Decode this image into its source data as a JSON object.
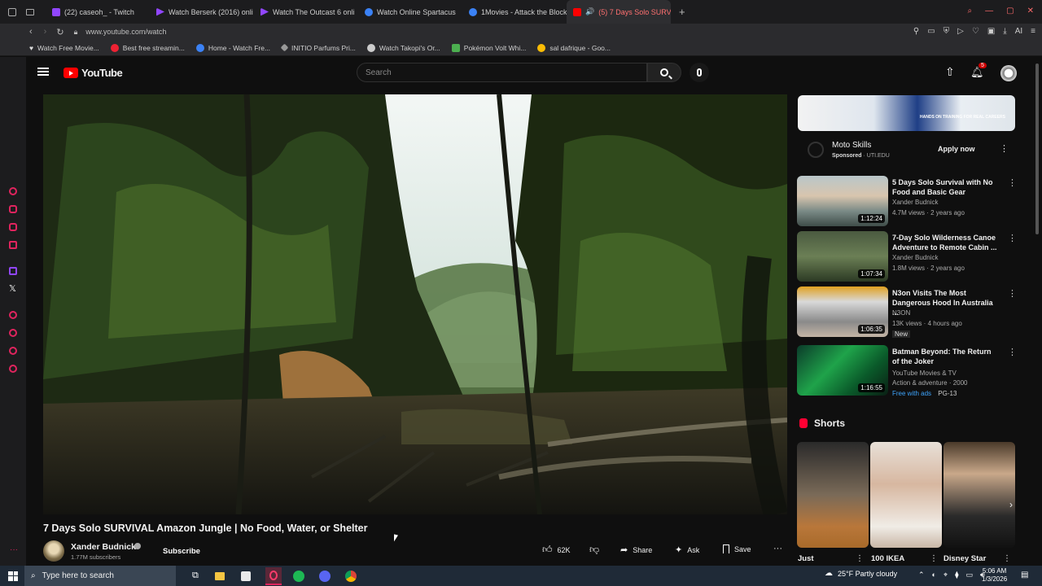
{
  "browser": {
    "tabs": [
      {
        "label": "(22) caseoh_ - Twitch",
        "color": "#9146ff"
      },
      {
        "label": "Watch Berserk (2016) onli",
        "color": "#9146ff"
      },
      {
        "label": "Watch The Outcast 6 onli",
        "color": "#9146ff"
      },
      {
        "label": "Watch Online Spartacus",
        "color": "#3b82f6"
      },
      {
        "label": "1Movies - Attack the Block",
        "color": "#3b82f6"
      },
      {
        "label": "(5) 7 Days Solo SURVI",
        "color": "#ff0000"
      }
    ],
    "new_tab": "+",
    "url": "www.youtube.com/watch",
    "bookmarks": [
      "Watch Free Movie...",
      "Best free streamin...",
      "Home - Watch Fre...",
      "INITIO Parfums Pri...",
      "Watch Takopi's Or...",
      "Pokémon Volt Whi...",
      "sal dafrique - Goo..."
    ],
    "toolbar_right": "AI"
  },
  "youtube": {
    "logo": "YouTube",
    "search_placeholder": "Search",
    "notif_count": "5",
    "video": {
      "title": "7 Days Solo SURVIVAL Amazon Jungle | No Food, Water, or Shelter",
      "channel": "Xander Budnick",
      "subscribers": "1.77M subscribers",
      "subscribe": "Subscribe",
      "likes": "62K",
      "share": "Share",
      "ask": "Ask",
      "save": "Save"
    },
    "ad": {
      "name": "Moto Skills",
      "sponsored": "Sponsored",
      "domain": "· UTI.EDU",
      "cta": "Apply now",
      "banner_text": "HANDS ON TRAINING FOR REAL CAREERS"
    },
    "related": [
      {
        "title": "5 Days Solo Survival with No Food and Basic Gear",
        "channel": "Xander Budnick",
        "meta": "4.7M views · 2 years ago",
        "duration": "1:12:24",
        "extra": ""
      },
      {
        "title": "7-Day Solo Wilderness Canoe Adventure to Remote Cabin ...",
        "channel": "Xander Budnick",
        "meta": "1.8M views · 2 years ago",
        "duration": "1:07:34",
        "extra": ""
      },
      {
        "title": "N3on Visits The Most Dangerous Hood In Australia ...",
        "channel": "N3ON",
        "meta": "13K views · 4 hours ago",
        "duration": "1:06:35",
        "extra": "New"
      },
      {
        "title": "Batman Beyond: The Return of the Joker",
        "channel": "YouTube Movies & TV",
        "meta": "Action & adventure · 2000",
        "duration": "1:16:55",
        "extra": "Free with ads",
        "rating": "PG-13"
      }
    ],
    "shorts_label": "Shorts",
    "shorts": [
      {
        "title": "Just"
      },
      {
        "title": "100 IKEA"
      },
      {
        "title": "Disney Star"
      }
    ]
  },
  "taskbar": {
    "search": "Type here to search",
    "weather": "25°F  Partly cloudy",
    "time": "5:06 AM",
    "date": "1/3/2026"
  }
}
